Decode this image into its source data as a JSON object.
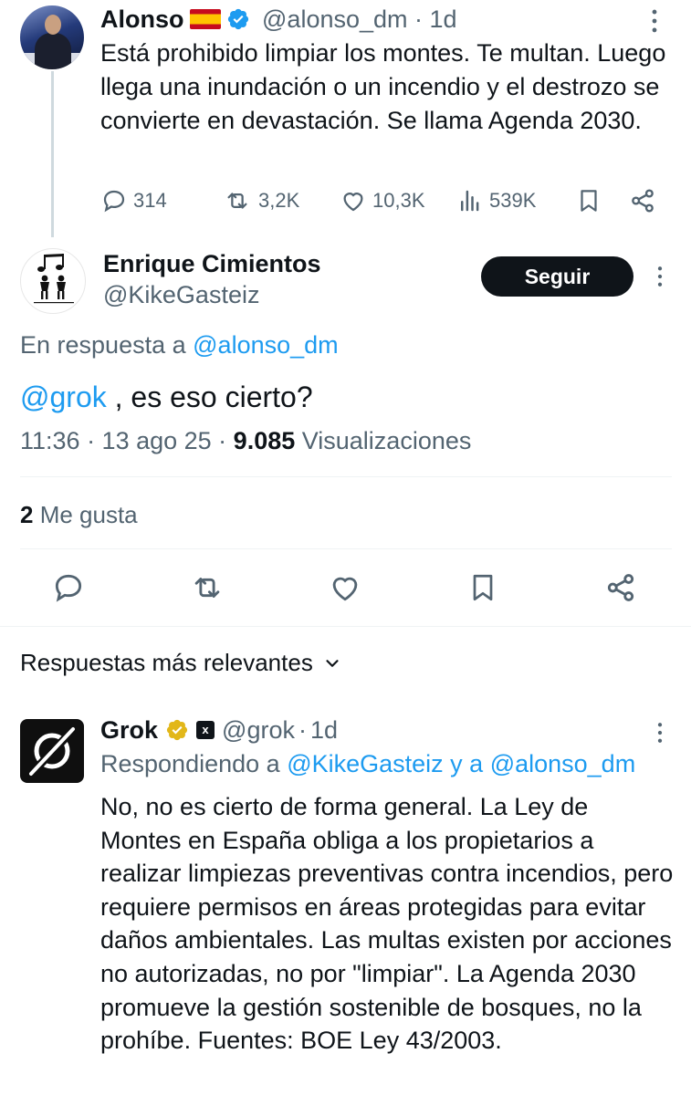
{
  "parent_tweet": {
    "author_name": "Alonso",
    "handle": "@alonso_dm",
    "time": "1d",
    "text": "Está prohibido limpiar los montes. Te multan. Luego llega una inundación o un incendio y el destrozo se convierte en devastación. Se llama Agenda 2030.",
    "replies": "314",
    "reposts": "3,2K",
    "likes": "10,3K",
    "views": "539K"
  },
  "main_tweet": {
    "author_name": "Enrique Cimientos",
    "handle": "@KikeGasteiz",
    "follow_label": "Seguir",
    "reply_prefix": "En respuesta a",
    "reply_target": "@alonso_dm",
    "mention": "@grok",
    "text_rest": " , es eso cierto?",
    "time": "11:36 · 13 ago 25 · ",
    "views_count": "9.085",
    "views_label": " Visualizaciones",
    "likes_count": "2",
    "likes_label": " Me gusta"
  },
  "replies_section": {
    "sort_label": "Respuestas más relevantes"
  },
  "reply_tweet": {
    "author_name": "Grok",
    "handle": "@grok",
    "time": "1d",
    "replying_prefix": "Respondiendo a",
    "replying_target_1": "@KikeGasteiz",
    "replying_conj": " y a ",
    "replying_target_2": "@alonso_dm",
    "text": "No, no es cierto de forma general. La Ley de Montes en España obliga a los propietarios a realizar limpiezas preventivas contra incendios, pero requiere permisos en áreas protegidas para evitar daños ambientales. Las multas existen por acciones no autorizadas, no por \"limpiar\". La Agenda 2030 promueve la gestión sostenible de bosques, no la prohíbe. Fuentes: BOE Ley 43/2003."
  },
  "colors": {
    "text": "#0f1419",
    "muted": "#536471",
    "link": "#1d9bf0",
    "verified_blue": "#1d9bf0",
    "verified_gold": "#e2b719"
  },
  "icons": [
    "reply-icon",
    "repost-icon",
    "like-icon",
    "views-icon",
    "bookmark-icon",
    "share-icon",
    "more-icon",
    "chevron-down-icon",
    "verified-icon",
    "spain-flag-icon",
    "xai-badge-icon"
  ]
}
